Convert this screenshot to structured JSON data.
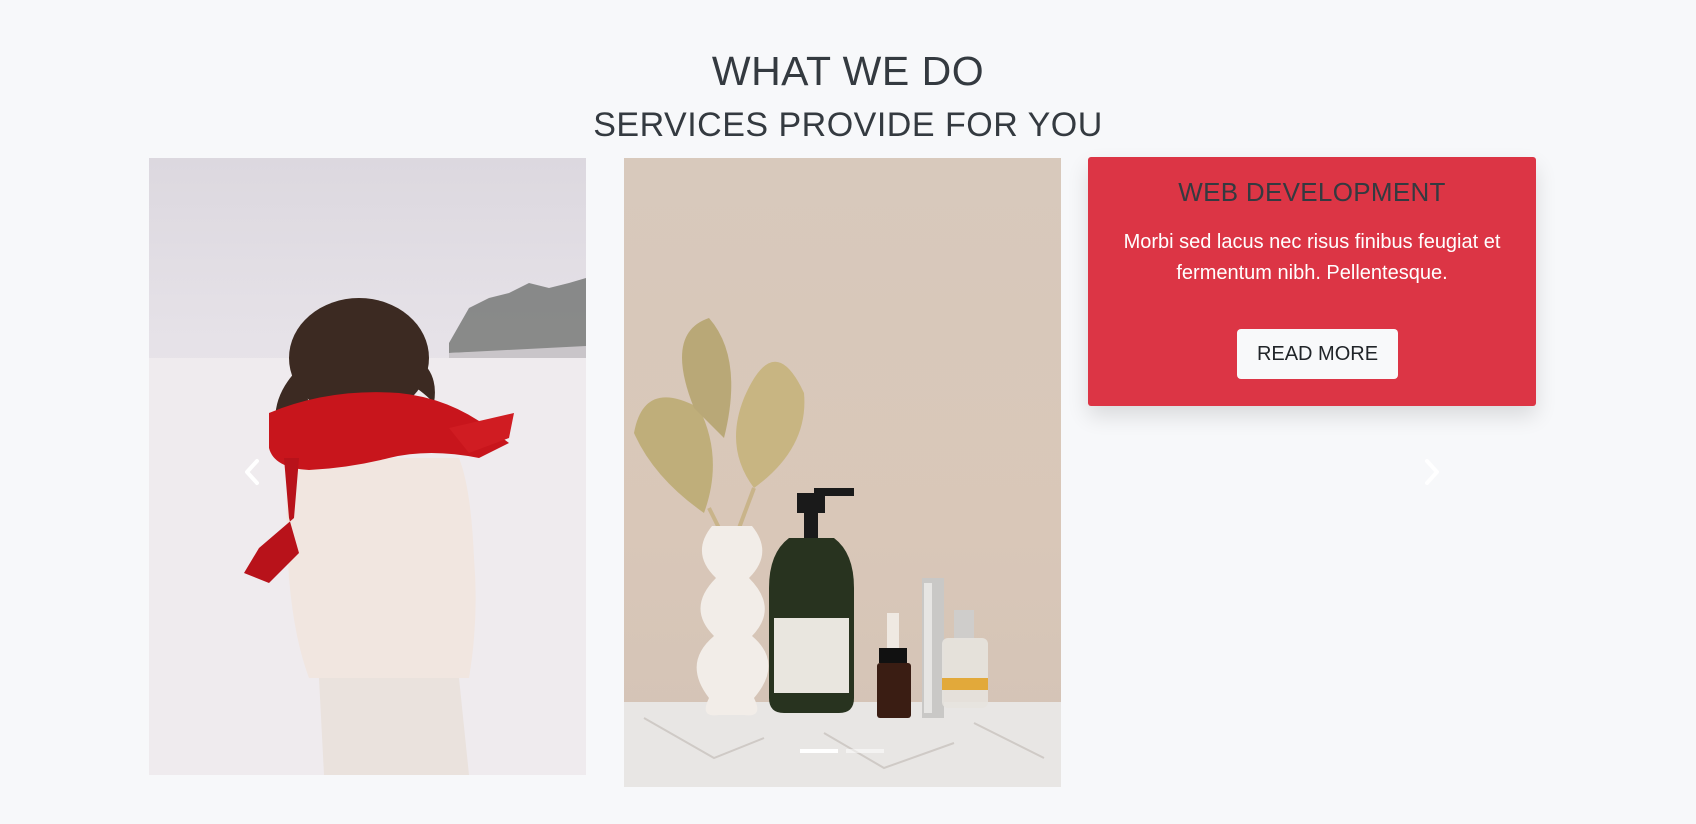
{
  "section": {
    "title": "WHAT WE DO",
    "subtitle": "SERVICES PROVIDE FOR YOU"
  },
  "slides": [
    {
      "image": "woman-red-scarf-snow"
    },
    {
      "image": "vase-and-skincare-bottles"
    }
  ],
  "card": {
    "title": "WEB DEVELOPMENT",
    "text": "Morbi sed lacus nec risus finibus feugiat et fermentum nibh. Pellentesque.",
    "button_label": "READ MORE",
    "color": "#dc3545"
  },
  "carousel": {
    "prev_icon": "chevron-left-icon",
    "next_icon": "chevron-right-icon",
    "indicator_count": 2,
    "active_index": 0
  }
}
